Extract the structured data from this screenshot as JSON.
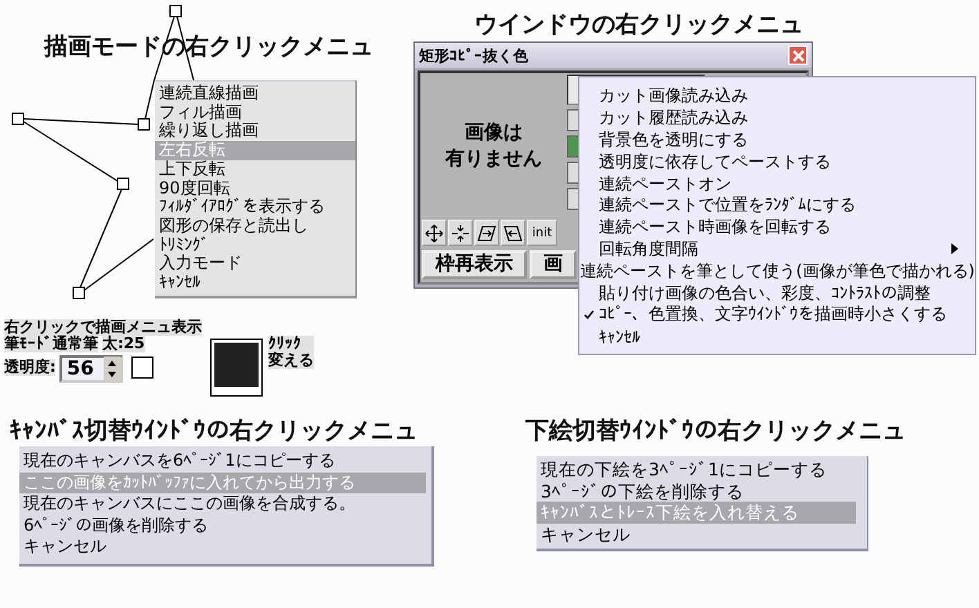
{
  "drawing_mode": {
    "title": "描画モードの右クリックメニュ",
    "menu": [
      {
        "label": "連続直線描画",
        "selected": false
      },
      {
        "label": "フィル描画",
        "selected": false
      },
      {
        "label": "繰り返し描画",
        "selected": false
      },
      {
        "label": "左右反転",
        "selected": true
      },
      {
        "label": "上下反転",
        "selected": false
      },
      {
        "label": "90度回転",
        "selected": false
      },
      {
        "label": "ﾌｨﾙﾀﾞｲｱﾛｸﾞを表示する",
        "selected": false
      },
      {
        "label": "図形の保存と読出し",
        "selected": false
      },
      {
        "label": "ﾄﾘﾐﾝｸﾞ",
        "selected": false
      },
      {
        "label": "入力モード",
        "selected": false
      },
      {
        "label": "ｷｬﾝｾﾙ",
        "selected": false
      }
    ],
    "status": {
      "hint": "右クリックで描画メニュ表示",
      "brush": "筆ﾓｰﾄﾞ通常筆",
      "size": "太:25",
      "opacity_label": "透明度:",
      "opacity_value": "56",
      "checked": false,
      "color": "#222222",
      "color_hint": [
        "ｸﾘｯｸ",
        "変える"
      ]
    }
  },
  "window_menu": {
    "title": "ウインドウの右クリックメニュ",
    "window": {
      "title": "矩形ｺﾋﾟｰ抜く色",
      "message": [
        "画像は",
        "有りません"
      ],
      "tool_label": "init",
      "buttons": [
        "枠再表示",
        "画"
      ]
    },
    "menu": [
      {
        "label": "カット画像読み込み",
        "checked": false,
        "submenu": false
      },
      {
        "label": "カット履歴読み込み",
        "checked": false,
        "submenu": false
      },
      {
        "label": "背景色を透明にする",
        "checked": false,
        "submenu": false
      },
      {
        "label": "透明度に依存してペーストする",
        "checked": false,
        "submenu": false
      },
      {
        "label": "連続ペーストオン",
        "checked": false,
        "submenu": false
      },
      {
        "label": "連続ペーストで位置をﾗﾝﾀﾞﾑにする",
        "checked": false,
        "submenu": false
      },
      {
        "label": "連続ペースト時画像を回転する",
        "checked": false,
        "submenu": false
      },
      {
        "label": "回転角度間隔",
        "checked": false,
        "submenu": true
      },
      {
        "label": "連続ペーストを筆として使う(画像が筆色で描かれる)",
        "checked": false,
        "submenu": false
      },
      {
        "label": "貼り付け画像の色合い、彩度、ｺﾝﾄﾗｽﾄの調整",
        "checked": false,
        "submenu": false
      },
      {
        "label": "ｺﾋﾟｰ、色置換、文字ｳｲﾝﾄﾞｳを描画時小さくする",
        "checked": true,
        "submenu": false
      },
      {
        "label": "ｷｬﾝｾﾙ",
        "checked": false,
        "submenu": false
      }
    ]
  },
  "canvas_switch": {
    "title": "ｷｬﾝﾊﾞｽ切替ｳｲﾝﾄﾞｳの右クリックメニュ",
    "menu": [
      {
        "label": "現在のキャンバスを6ﾍﾟｰｼﾞ1にコピーする",
        "selected": false
      },
      {
        "label": "ここの画像をｶｯﾄﾊﾞｯﾌｧに入れてから出力する",
        "selected": true
      },
      {
        "label": "現在のキャンバスにここの画像を合成する。",
        "selected": false
      },
      {
        "label": "6ﾍﾟｰｼﾞの画像を削除する",
        "selected": false
      },
      {
        "label": "キャンセル",
        "selected": false
      }
    ]
  },
  "underlay_switch": {
    "title": "下絵切替ｳｲﾝﾄﾞｳの右クリックメニュ",
    "menu": [
      {
        "label": "現在の下絵を3ﾍﾟｰｼﾞ1にコピーする",
        "selected": false
      },
      {
        "label": "3ﾍﾟｰｼﾞの下絵を削除する",
        "selected": false
      },
      {
        "label": "ｷｬﾝﾊﾞｽとﾄﾚｰｽ下絵を入れ替える",
        "selected": true
      },
      {
        "label": "キャンセル",
        "selected": false
      }
    ]
  }
}
